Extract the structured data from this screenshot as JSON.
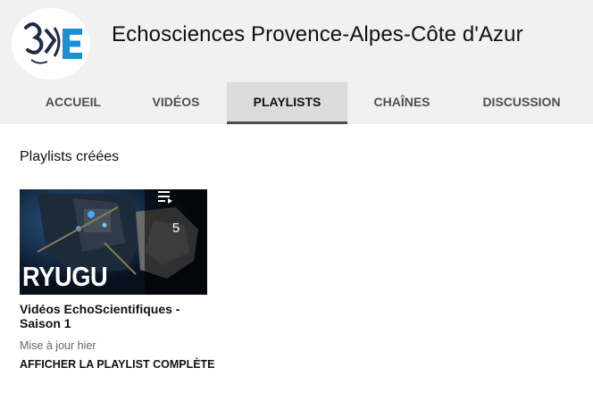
{
  "channel": {
    "name": "Echosciences Provence-Alpes-Côte d'Azur",
    "logo_icon": "echosciences-logo-icon"
  },
  "tabs": [
    {
      "label": "ACCUEIL",
      "active": false
    },
    {
      "label": "VIDÉOS",
      "active": false
    },
    {
      "label": "PLAYLISTS",
      "active": true
    },
    {
      "label": "CHAÎNES",
      "active": false
    },
    {
      "label": "DISCUSSION",
      "active": false
    }
  ],
  "section": {
    "title": "Playlists créées"
  },
  "playlists": [
    {
      "thumbnail_text": "RYUGU",
      "video_count": "5",
      "count_icon": "playlist-icon",
      "title": "Vidéos EchoScientifiques - Saison 1",
      "updated": "Mise à jour hier",
      "view_all": "AFFICHER LA PLAYLIST COMPLÈTE"
    }
  ],
  "colors": {
    "header_bg": "#f1f1f1",
    "active_tab_bg": "#dcdcdc",
    "logo_blue": "#1a8fd1",
    "logo_dark": "#1f2a44"
  }
}
